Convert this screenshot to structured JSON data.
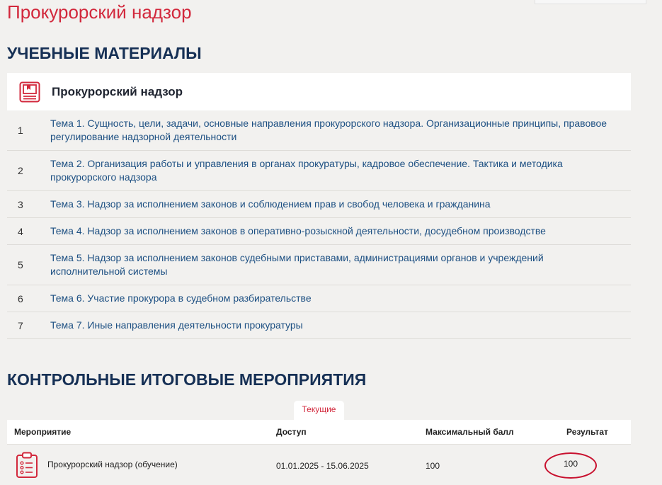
{
  "page": {
    "title": "Прокурорский надзор"
  },
  "materials": {
    "section_title": "УЧЕБНЫЕ МАТЕРИАЛЫ",
    "course": {
      "name": "Прокурорский надзор",
      "icon": "book-icon"
    },
    "topics": [
      {
        "num": "1",
        "title": "Тема 1. Сущность, цели, задачи, основные направления прокурорского надзора. Организационные принципы, правовое регулирование надзорной деятельности"
      },
      {
        "num": "2",
        "title": "Тема 2. Организация работы и управления в органах прокуратуры, кадровое обеспечение. Тактика и методика прокурорского надзора"
      },
      {
        "num": "3",
        "title": "Тема 3. Надзор за исполнением законов и соблюдением прав и свобод человека и гражданина"
      },
      {
        "num": "4",
        "title": "Тема 4. Надзор за исполнением законов в оперативно-розыскной деятельности, досудебном производстве"
      },
      {
        "num": "5",
        "title": "Тема 5. Надзор за исполнением законов судебными приставами, администрациями органов и учреждений исполнительной системы"
      },
      {
        "num": "6",
        "title": "Тема 6. Участие прокурора в судебном разбирательстве"
      },
      {
        "num": "7",
        "title": "Тема 7. Иные направления деятельности прокуратуры"
      }
    ]
  },
  "events": {
    "section_title": "КОНТРОЛЬНЫЕ ИТОГОВЫЕ МЕРОПРИЯТИЯ",
    "tab_current": "Текущие",
    "headers": {
      "event": "Мероприятие",
      "access": "Доступ",
      "max_score": "Максимальный балл",
      "result": "Результат"
    },
    "rows": [
      {
        "event": "Прокурорский надзор (обучение)",
        "access": "01.01.2025 - 15.06.2025",
        "max_score": "100",
        "result": "100",
        "icon": "clipboard-icon"
      }
    ]
  },
  "colors": {
    "accent_red": "#d2283c",
    "heading_navy": "#163055",
    "link_blue": "#1c4f82",
    "background": "#f2f1ef",
    "annotation_red": "#c8102e"
  }
}
